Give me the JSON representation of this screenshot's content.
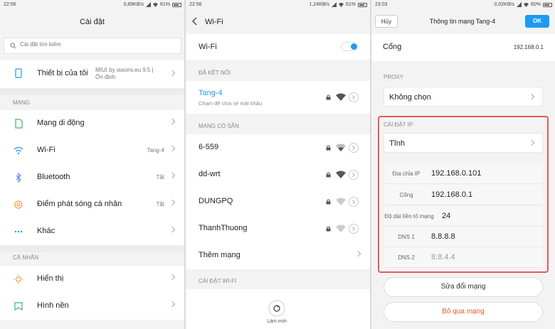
{
  "panel1": {
    "status": {
      "time": "22:56",
      "speed": "0,89KB/s",
      "battery": "61%"
    },
    "title": "Cài đặt",
    "search_placeholder": "Cài đặt tìm kiếm",
    "device": {
      "label": "Thiết bị của tôi",
      "value": "MIUI by xiaomi.eu 9.5 | Ổn định"
    },
    "section_network": "MẠNG",
    "network_items": [
      {
        "label": "Mạng di động",
        "value": "",
        "icon": "sim-icon"
      },
      {
        "label": "Wi-Fi",
        "value": "Tang-4",
        "icon": "wifi-icon"
      },
      {
        "label": "Bluetooth",
        "value": "Tắt",
        "icon": "bluetooth-icon"
      },
      {
        "label": "Điểm phát sóng cá nhân",
        "value": "Tắt",
        "icon": "hotspot-icon"
      },
      {
        "label": "Khác",
        "value": "",
        "icon": "more-icon"
      }
    ],
    "section_personal": "CÁ NHÂN",
    "personal_items": [
      {
        "label": "Hiển thị",
        "icon": "display-icon"
      },
      {
        "label": "Hình nền",
        "icon": "wallpaper-icon"
      }
    ],
    "accent": "#1f9af2"
  },
  "panel2": {
    "status": {
      "time": "22:56",
      "speed": "1,24KB/s",
      "battery": "61%"
    },
    "title": "Wi-Fi",
    "wifi_label": "Wi-Fi",
    "section_connected": "ĐÃ KẾT NỐI",
    "connected": {
      "name": "Tang-4",
      "sub": "Chạm để chia sẻ mật khẩu"
    },
    "section_available": "MẠNG CÓ SẴN",
    "networks": [
      "6-559",
      "dd-wrt",
      "DUNGPQ",
      "ThanhThuong"
    ],
    "add_network": "Thêm mạng",
    "section_settings": "CÀI ĐẶT WI-FI",
    "refresh": "Làm mới"
  },
  "panel3": {
    "status": {
      "time": "23:03",
      "speed": "0,02KB/s",
      "battery": "60%"
    },
    "cancel": "Hủy",
    "title": "Thông tin mạng Tang-4",
    "ok": "OK",
    "gateway": {
      "label": "Cổng",
      "value": "192.168.0.1"
    },
    "section_proxy": "PROXY",
    "proxy_value": "Không chọn",
    "section_ip": "CÀI ĐẶT IP",
    "ip_mode": "Tĩnh",
    "ip_rows": [
      {
        "key": "Địa chỉa IP",
        "value": "192.168.0.101"
      },
      {
        "key": "Cổng",
        "value": "192.168.0.1"
      },
      {
        "key": "Độ dài tiền tố mạng",
        "value": "24"
      },
      {
        "key": "DNS 1",
        "value": "8.8.8.8"
      },
      {
        "key": "DNS 2",
        "value": "8.8.4.4"
      }
    ],
    "modify": "Sửa đổi mạng",
    "forget": "Bỏ qua mạng",
    "forget_color": "#e8572a",
    "highlight_color": "#e55a5a"
  }
}
